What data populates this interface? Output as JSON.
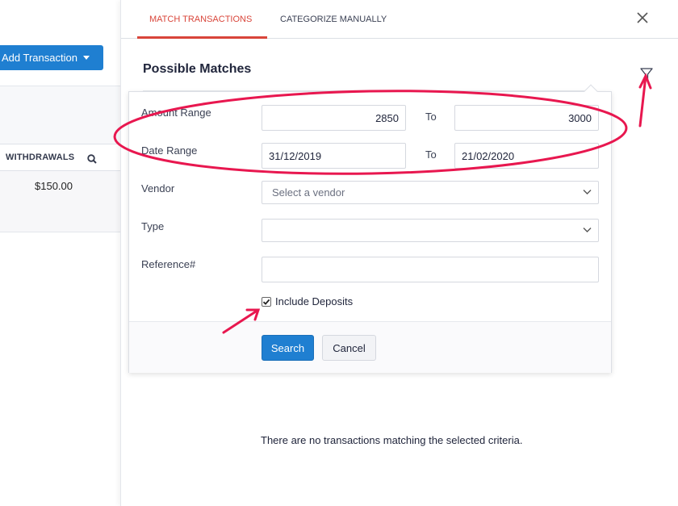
{
  "left": {
    "add_transaction_label": "Add Transaction",
    "withdrawals_header": "WITHDRAWALS",
    "row_amount": "$150.00"
  },
  "tabs": {
    "match": "MATCH TRANSACTIONS",
    "categorize": "CATEGORIZE MANUALLY"
  },
  "main": {
    "title": "Possible Matches",
    "empty_message": "There are no transactions matching the selected criteria."
  },
  "filter": {
    "amount_range_label": "Amount Range",
    "amount_from": "2850",
    "amount_to": "3000",
    "to_label": "To",
    "date_range_label": "Date Range",
    "date_from": "31/12/2019",
    "date_to": "21/02/2020",
    "vendor_label": "Vendor",
    "vendor_placeholder": "Select a vendor",
    "type_label": "Type",
    "type_value": "",
    "reference_label": "Reference#",
    "reference_value": "",
    "include_deposits_label": "Include Deposits",
    "include_deposits_checked": true,
    "search_button": "Search",
    "cancel_button": "Cancel"
  },
  "colors": {
    "accent_blue": "#1f7fd1",
    "active_tab_red": "#d9453a",
    "annotation_pink": "#e8174f"
  }
}
